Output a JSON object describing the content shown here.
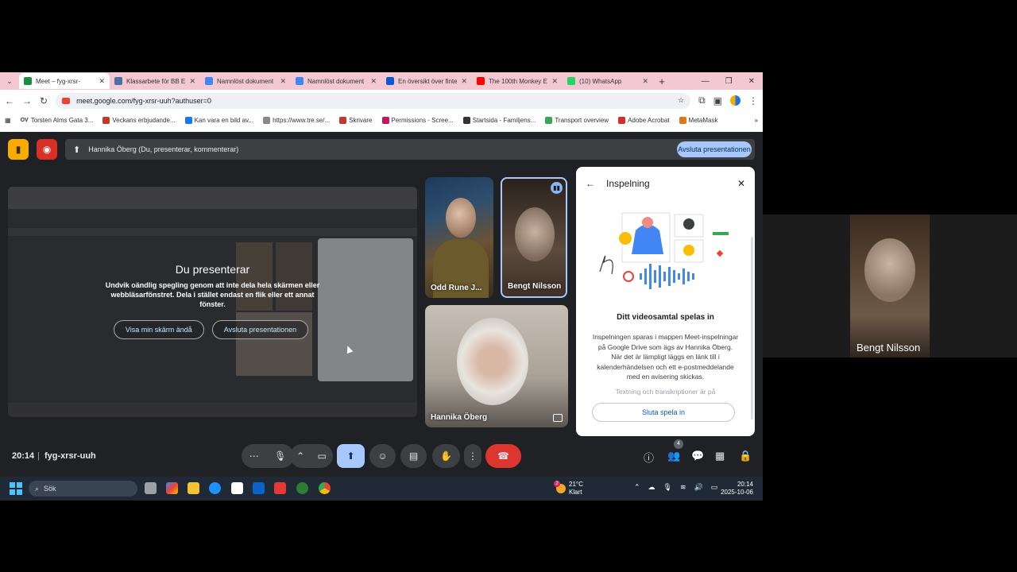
{
  "browser": {
    "tabs": [
      {
        "title": "Meet – fyg-xrsr-",
        "color": "#1e8e3e",
        "active": true
      },
      {
        "title": "Klassarbete för BB Ek",
        "color": "#4a6fa5"
      },
      {
        "title": "Namnlöst dokument",
        "color": "#4285f4"
      },
      {
        "title": "Namnlöst dokument",
        "color": "#4285f4"
      },
      {
        "title": "En översikt över finte",
        "color": "#0b57d0"
      },
      {
        "title": "The 100th Monkey E",
        "color": "#ff0000"
      },
      {
        "title": "(10) WhatsApp",
        "color": "#25d366"
      }
    ],
    "url": "meet.google.com/fyg-xrsr-uuh?authuser=0",
    "bookmarks": [
      {
        "label": "Torsten Alms Gata 3...",
        "icon": "OV"
      },
      {
        "label": "Veckans erbjudande...",
        "color": "#c0392b"
      },
      {
        "label": "Kan vara en bild av...",
        "color": "#1877f2"
      },
      {
        "label": "https://www.tre.se/...",
        "color": "#888888"
      },
      {
        "label": "Skrivare",
        "color": "#c0392b"
      },
      {
        "label": "Permissions - Scree...",
        "color": "#c2185b"
      },
      {
        "label": "Startsida - Familjens...",
        "color": "#333333"
      },
      {
        "label": "Transport overview",
        "color": "#34a853"
      },
      {
        "label": "Adobe Acrobat",
        "color": "#d32f2f"
      },
      {
        "label": "MetaMask",
        "color": "#e2761b"
      }
    ]
  },
  "meet": {
    "presenting_bar": "Hannika Öberg (Du, presenterar, kommenterar)",
    "end_presentation_top": "Avsluta presentationen",
    "overlay": {
      "title": "Du presenterar",
      "text": "Undvik oändlig spegling genom att inte dela hela skärmen eller webbläsarfönstret. Dela i stället endast en flik eller ett annat fönster.",
      "show_screen_btn": "Visa min skärm ändå",
      "stop_btn": "Avsluta presentationen"
    },
    "participants": {
      "odd": "Odd Rune J...",
      "bengt": "Bengt Nilsson",
      "hannika": "Hannika Öberg"
    },
    "panel": {
      "title": "Inspelning",
      "subtitle": "Ditt videosamtal spelas in",
      "description": "Inspelningen sparas i mappen Meet-inspelningar på Google Drive som ägs av Hannika Öberg. När det är lämpligt läggs en länk till i kalenderhändelsen och ett e-postmeddelande med en avisering skickas.",
      "faded": "Textning och transkriptioner är på",
      "stop_recording": "Sluta spela in"
    },
    "time": "20:14",
    "meeting_code": "fyg-xrsr-uuh",
    "people_count": "4"
  },
  "side_video": {
    "name": "Bengt Nilsson"
  },
  "taskbar": {
    "search": "Sök",
    "weather_temp": "21°C",
    "weather_text": "Klart",
    "weather_badge": "2",
    "time": "20:14",
    "date": "2025-10-06"
  }
}
